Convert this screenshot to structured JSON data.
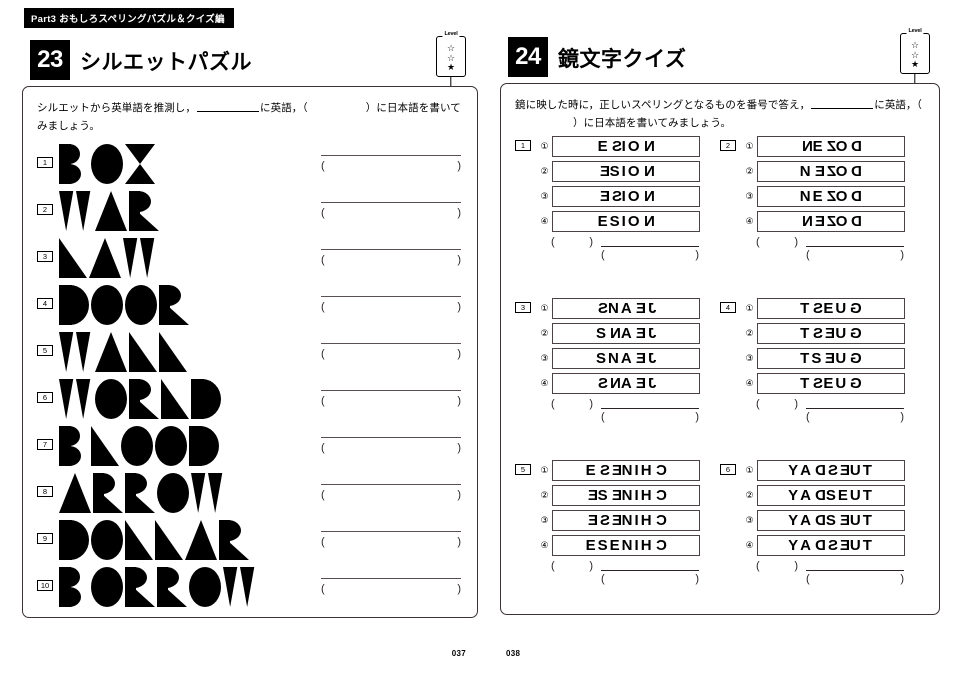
{
  "part_banner": "Part3  おもしろスペリングパズル＆クイズ編",
  "left_page": {
    "chapter_number": "23",
    "chapter_title": "シルエットパズル",
    "level": {
      "label": "Level",
      "stars": [
        "☆",
        "☆",
        "★"
      ]
    },
    "instruction_pre": "シルエットから英単語を推測し，",
    "instruction_mid": "に英語，（",
    "instruction_post": "）に日本語を書いてみましょう。",
    "folio": "037",
    "answer_paren_open": "(",
    "answer_paren_close": ")",
    "problems": [
      {
        "num": "1",
        "word": "BOX"
      },
      {
        "num": "2",
        "word": "WAR"
      },
      {
        "num": "3",
        "word": "LAW"
      },
      {
        "num": "4",
        "word": "DOOR"
      },
      {
        "num": "5",
        "word": "WALL"
      },
      {
        "num": "6",
        "word": "WORLD"
      },
      {
        "num": "7",
        "word": "BLOOD"
      },
      {
        "num": "8",
        "word": "ARROW"
      },
      {
        "num": "9",
        "word": "DOLLAR"
      },
      {
        "num": "10",
        "word": "BORROW"
      }
    ]
  },
  "right_page": {
    "chapter_number": "24",
    "chapter_title": "鏡文字クイズ",
    "level": {
      "label": "Level",
      "stars": [
        "☆",
        "☆",
        "★"
      ]
    },
    "instruction_pre": "鏡に映した時に，正しいスペリングとなるものを番号で答え，",
    "instruction_mid": "に英語，（",
    "instruction_post": "）に日本語を書いてみましょう。",
    "folio": "038",
    "option_numbers": [
      "①",
      "②",
      "③",
      "④"
    ],
    "answer_paren_open": "(",
    "answer_paren_close": ")",
    "problems": [
      {
        "num": "1",
        "answer_word": "NOISE",
        "options": [
          {
            "label": "①",
            "letters": [
              {
                "c": "E",
                "m": false
              },
              {
                "c": "S",
                "m": true
              },
              {
                "c": "I",
                "m": false
              },
              {
                "c": "O",
                "m": false
              },
              {
                "c": "N",
                "m": true
              }
            ]
          },
          {
            "label": "②",
            "letters": [
              {
                "c": "E",
                "m": true
              },
              {
                "c": "S",
                "m": false
              },
              {
                "c": "I",
                "m": false
              },
              {
                "c": "O",
                "m": false
              },
              {
                "c": "N",
                "m": true
              }
            ]
          },
          {
            "label": "③",
            "letters": [
              {
                "c": "E",
                "m": true
              },
              {
                "c": "S",
                "m": true
              },
              {
                "c": "I",
                "m": false
              },
              {
                "c": "O",
                "m": false
              },
              {
                "c": "N",
                "m": true
              }
            ]
          },
          {
            "label": "④",
            "letters": [
              {
                "c": "E",
                "m": false
              },
              {
                "c": "S",
                "m": false
              },
              {
                "c": "I",
                "m": false
              },
              {
                "c": "O",
                "m": false
              },
              {
                "c": "N",
                "m": true
              }
            ]
          }
        ]
      },
      {
        "num": "2",
        "answer_word": "DOZEN",
        "options": [
          {
            "label": "①",
            "letters": [
              {
                "c": "N",
                "m": true
              },
              {
                "c": "E",
                "m": false
              },
              {
                "c": "Z",
                "m": true
              },
              {
                "c": "O",
                "m": false
              },
              {
                "c": "D",
                "m": true
              }
            ]
          },
          {
            "label": "②",
            "letters": [
              {
                "c": "N",
                "m": false
              },
              {
                "c": "E",
                "m": true
              },
              {
                "c": "Z",
                "m": true
              },
              {
                "c": "O",
                "m": false
              },
              {
                "c": "D",
                "m": true
              }
            ]
          },
          {
            "label": "③",
            "letters": [
              {
                "c": "N",
                "m": false
              },
              {
                "c": "E",
                "m": false
              },
              {
                "c": "Z",
                "m": true
              },
              {
                "c": "O",
                "m": false
              },
              {
                "c": "D",
                "m": true
              }
            ]
          },
          {
            "label": "④",
            "letters": [
              {
                "c": "N",
                "m": true
              },
              {
                "c": "E",
                "m": true
              },
              {
                "c": "Z",
                "m": true
              },
              {
                "c": "O",
                "m": false
              },
              {
                "c": "D",
                "m": true
              }
            ]
          }
        ]
      },
      {
        "num": "3",
        "answer_word": "JEANS",
        "options": [
          {
            "label": "①",
            "letters": [
              {
                "c": "S",
                "m": true
              },
              {
                "c": "N",
                "m": false
              },
              {
                "c": "A",
                "m": false
              },
              {
                "c": "E",
                "m": true
              },
              {
                "c": "J",
                "m": true
              }
            ]
          },
          {
            "label": "②",
            "letters": [
              {
                "c": "S",
                "m": false
              },
              {
                "c": "N",
                "m": true
              },
              {
                "c": "A",
                "m": false
              },
              {
                "c": "E",
                "m": true
              },
              {
                "c": "J",
                "m": true
              }
            ]
          },
          {
            "label": "③",
            "letters": [
              {
                "c": "S",
                "m": false
              },
              {
                "c": "N",
                "m": false
              },
              {
                "c": "A",
                "m": false
              },
              {
                "c": "E",
                "m": true
              },
              {
                "c": "J",
                "m": true
              }
            ]
          },
          {
            "label": "④",
            "letters": [
              {
                "c": "S",
                "m": true
              },
              {
                "c": "N",
                "m": true
              },
              {
                "c": "A",
                "m": false
              },
              {
                "c": "E",
                "m": true
              },
              {
                "c": "J",
                "m": true
              }
            ]
          }
        ]
      },
      {
        "num": "4",
        "answer_word": "GUEST",
        "options": [
          {
            "label": "①",
            "letters": [
              {
                "c": "T",
                "m": false
              },
              {
                "c": "S",
                "m": true
              },
              {
                "c": "E",
                "m": false
              },
              {
                "c": "U",
                "m": false
              },
              {
                "c": "G",
                "m": true
              }
            ]
          },
          {
            "label": "②",
            "letters": [
              {
                "c": "T",
                "m": false
              },
              {
                "c": "S",
                "m": true
              },
              {
                "c": "E",
                "m": true
              },
              {
                "c": "U",
                "m": false
              },
              {
                "c": "G",
                "m": true
              }
            ]
          },
          {
            "label": "③",
            "letters": [
              {
                "c": "T",
                "m": false
              },
              {
                "c": "S",
                "m": false
              },
              {
                "c": "E",
                "m": true
              },
              {
                "c": "U",
                "m": false
              },
              {
                "c": "G",
                "m": true
              }
            ]
          },
          {
            "label": "④",
            "letters": [
              {
                "c": "T",
                "m": false
              },
              {
                "c": "S",
                "m": true
              },
              {
                "c": "E",
                "m": false
              },
              {
                "c": "U",
                "m": false
              },
              {
                "c": "G",
                "m": true
              }
            ]
          }
        ]
      },
      {
        "num": "5",
        "answer_word": "CHINESE",
        "options": [
          {
            "label": "①",
            "letters": [
              {
                "c": "E",
                "m": false
              },
              {
                "c": "S",
                "m": true
              },
              {
                "c": "E",
                "m": true
              },
              {
                "c": "N",
                "m": false
              },
              {
                "c": "I",
                "m": false
              },
              {
                "c": "H",
                "m": false
              },
              {
                "c": "C",
                "m": true
              }
            ]
          },
          {
            "label": "②",
            "letters": [
              {
                "c": "E",
                "m": true
              },
              {
                "c": "S",
                "m": false
              },
              {
                "c": "E",
                "m": true
              },
              {
                "c": "N",
                "m": false
              },
              {
                "c": "I",
                "m": false
              },
              {
                "c": "H",
                "m": false
              },
              {
                "c": "C",
                "m": true
              }
            ]
          },
          {
            "label": "③",
            "letters": [
              {
                "c": "E",
                "m": true
              },
              {
                "c": "S",
                "m": true
              },
              {
                "c": "E",
                "m": true
              },
              {
                "c": "N",
                "m": false
              },
              {
                "c": "I",
                "m": false
              },
              {
                "c": "H",
                "m": false
              },
              {
                "c": "C",
                "m": true
              }
            ]
          },
          {
            "label": "④",
            "letters": [
              {
                "c": "E",
                "m": false
              },
              {
                "c": "S",
                "m": false
              },
              {
                "c": "E",
                "m": false
              },
              {
                "c": "N",
                "m": false
              },
              {
                "c": "I",
                "m": false
              },
              {
                "c": "H",
                "m": false
              },
              {
                "c": "C",
                "m": true
              }
            ]
          }
        ]
      },
      {
        "num": "6",
        "answer_word": "TUESDAY",
        "options": [
          {
            "label": "①",
            "letters": [
              {
                "c": "Y",
                "m": false
              },
              {
                "c": "A",
                "m": false
              },
              {
                "c": "D",
                "m": true
              },
              {
                "c": "S",
                "m": true
              },
              {
                "c": "E",
                "m": true
              },
              {
                "c": "U",
                "m": false
              },
              {
                "c": "T",
                "m": false
              }
            ]
          },
          {
            "label": "②",
            "letters": [
              {
                "c": "Y",
                "m": false
              },
              {
                "c": "A",
                "m": false
              },
              {
                "c": "D",
                "m": true
              },
              {
                "c": "S",
                "m": false
              },
              {
                "c": "E",
                "m": false
              },
              {
                "c": "U",
                "m": false
              },
              {
                "c": "T",
                "m": false
              }
            ]
          },
          {
            "label": "③",
            "letters": [
              {
                "c": "Y",
                "m": false
              },
              {
                "c": "A",
                "m": false
              },
              {
                "c": "D",
                "m": true
              },
              {
                "c": "S",
                "m": false
              },
              {
                "c": "E",
                "m": true
              },
              {
                "c": "U",
                "m": false
              },
              {
                "c": "T",
                "m": false
              }
            ]
          },
          {
            "label": "④",
            "letters": [
              {
                "c": "Y",
                "m": false
              },
              {
                "c": "A",
                "m": false
              },
              {
                "c": "D",
                "m": true
              },
              {
                "c": "S",
                "m": true
              },
              {
                "c": "E",
                "m": true
              },
              {
                "c": "U",
                "m": false
              },
              {
                "c": "T",
                "m": false
              }
            ]
          }
        ]
      }
    ]
  }
}
